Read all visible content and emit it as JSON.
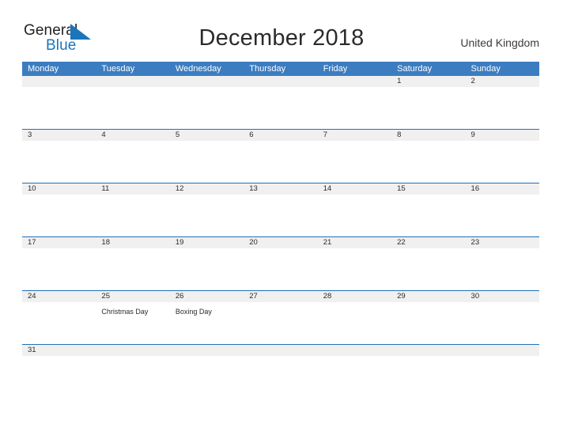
{
  "brand": {
    "name_part1": "General",
    "name_part2": "Blue",
    "accent_color": "#1b75bb",
    "flag_icon": "triangle-flag-icon"
  },
  "header": {
    "title": "December 2018",
    "country": "United Kingdom"
  },
  "theme": {
    "header_blue": "#3b7dc0",
    "rule_blue": "#2171b5",
    "band_gray": "#f0f0f0",
    "text_dark": "#2b2b2b"
  },
  "calendar": {
    "month": "December",
    "year": "2018",
    "weekday_headers": [
      "Monday",
      "Tuesday",
      "Wednesday",
      "Thursday",
      "Friday",
      "Saturday",
      "Sunday"
    ],
    "weeks": [
      {
        "days": [
          {
            "number": "",
            "event": ""
          },
          {
            "number": "",
            "event": ""
          },
          {
            "number": "",
            "event": ""
          },
          {
            "number": "",
            "event": ""
          },
          {
            "number": "",
            "event": ""
          },
          {
            "number": "1",
            "event": ""
          },
          {
            "number": "2",
            "event": ""
          }
        ]
      },
      {
        "days": [
          {
            "number": "3",
            "event": ""
          },
          {
            "number": "4",
            "event": ""
          },
          {
            "number": "5",
            "event": ""
          },
          {
            "number": "6",
            "event": ""
          },
          {
            "number": "7",
            "event": ""
          },
          {
            "number": "8",
            "event": ""
          },
          {
            "number": "9",
            "event": ""
          }
        ]
      },
      {
        "days": [
          {
            "number": "10",
            "event": ""
          },
          {
            "number": "11",
            "event": ""
          },
          {
            "number": "12",
            "event": ""
          },
          {
            "number": "13",
            "event": ""
          },
          {
            "number": "14",
            "event": ""
          },
          {
            "number": "15",
            "event": ""
          },
          {
            "number": "16",
            "event": ""
          }
        ]
      },
      {
        "days": [
          {
            "number": "17",
            "event": ""
          },
          {
            "number": "18",
            "event": ""
          },
          {
            "number": "19",
            "event": ""
          },
          {
            "number": "20",
            "event": ""
          },
          {
            "number": "21",
            "event": ""
          },
          {
            "number": "22",
            "event": ""
          },
          {
            "number": "23",
            "event": ""
          }
        ]
      },
      {
        "days": [
          {
            "number": "24",
            "event": ""
          },
          {
            "number": "25",
            "event": "Christmas Day"
          },
          {
            "number": "26",
            "event": "Boxing Day"
          },
          {
            "number": "27",
            "event": ""
          },
          {
            "number": "28",
            "event": ""
          },
          {
            "number": "29",
            "event": ""
          },
          {
            "number": "30",
            "event": ""
          }
        ]
      },
      {
        "days": [
          {
            "number": "31",
            "event": ""
          },
          {
            "number": "",
            "event": ""
          },
          {
            "number": "",
            "event": ""
          },
          {
            "number": "",
            "event": ""
          },
          {
            "number": "",
            "event": ""
          },
          {
            "number": "",
            "event": ""
          },
          {
            "number": "",
            "event": ""
          }
        ]
      }
    ]
  }
}
